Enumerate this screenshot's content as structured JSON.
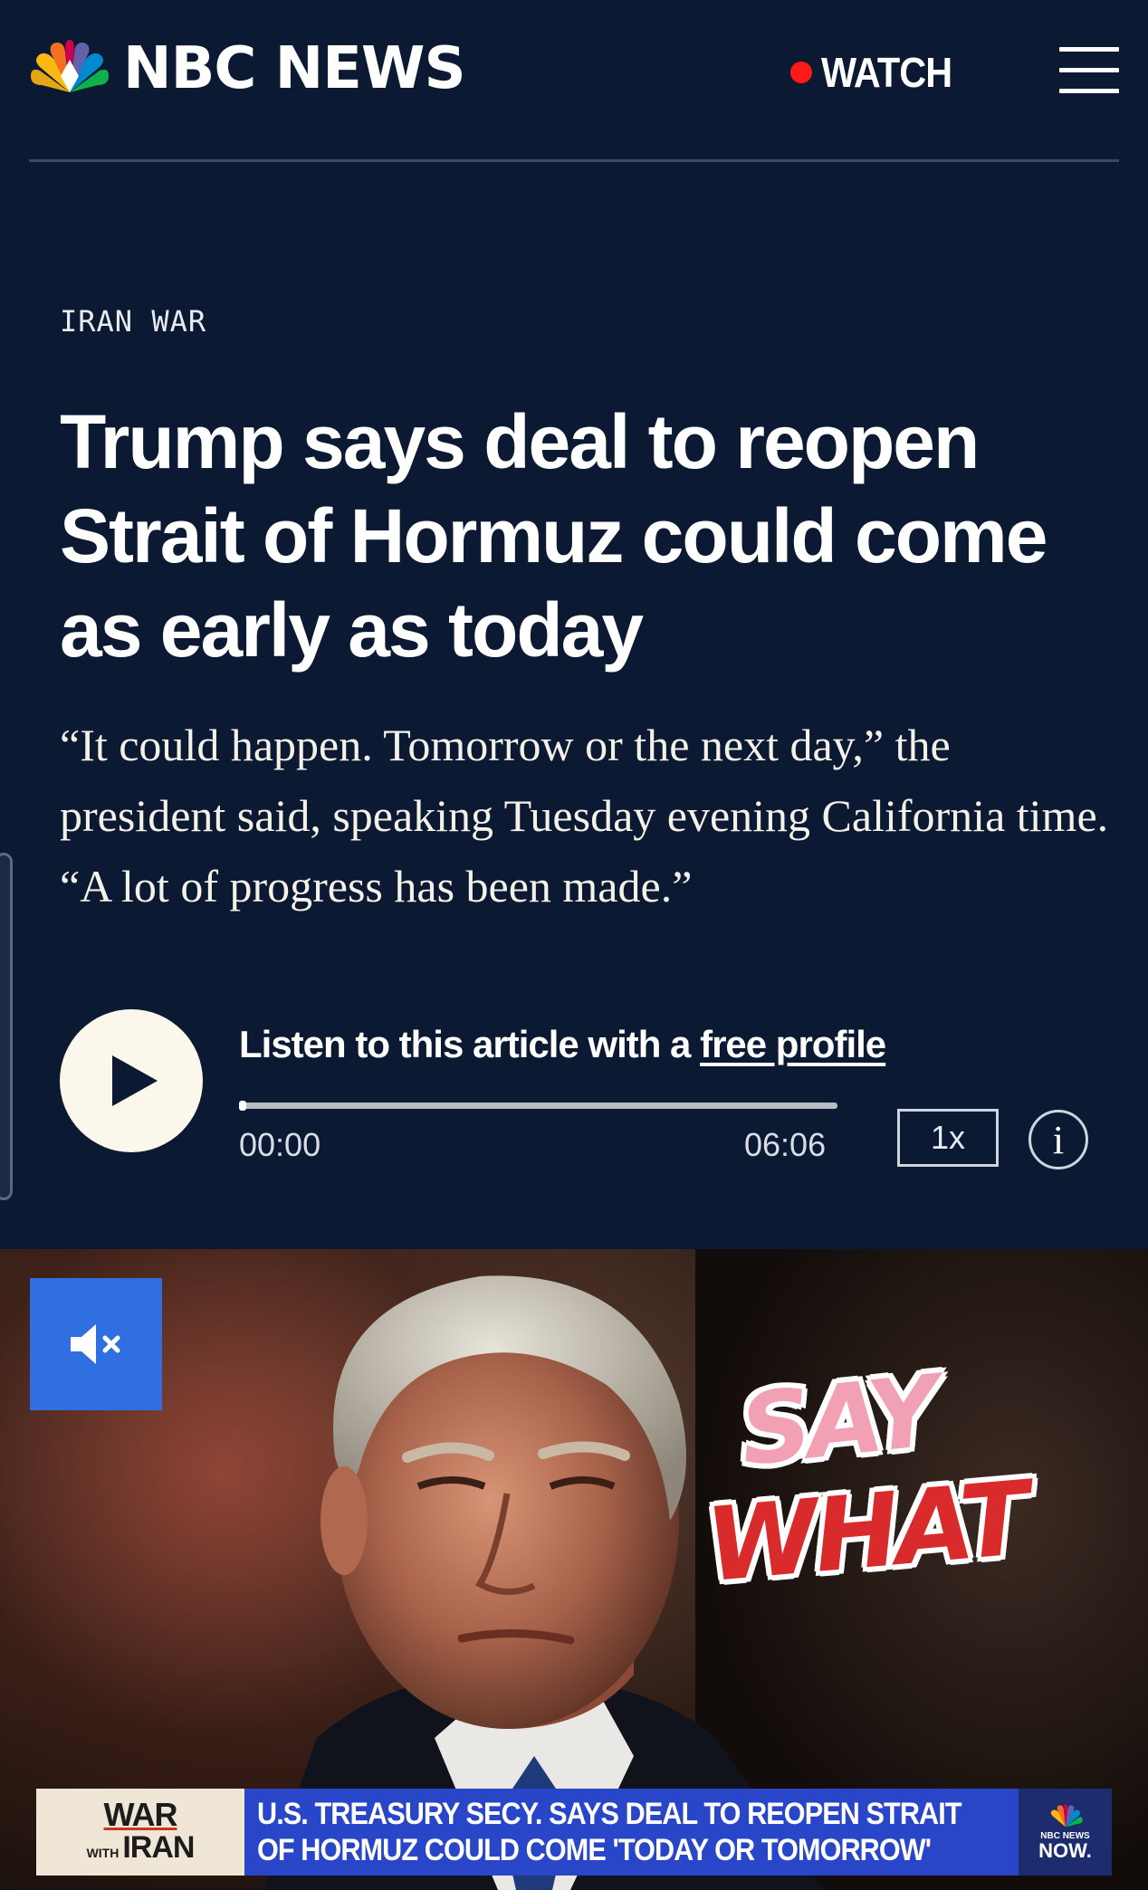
{
  "header": {
    "brand": "NBC NEWS",
    "watch_label": "WATCH"
  },
  "article": {
    "kicker": "IRAN WAR",
    "headline": "Trump says deal to reopen Strait of Hormuz could come as early as today",
    "dek": "“It could happen. Tomorrow or the next day,” the president said, speaking Tuesday evening California time. “A lot of progress has been made.”"
  },
  "audio": {
    "listen_prefix": "Listen to this article with a",
    "listen_link": "free profile",
    "current_time": "00:00",
    "duration": "06:06",
    "speed": "1x",
    "info_glyph": "i",
    "progress": 0.0
  },
  "video": {
    "sticker_top": "SAY",
    "sticker_bottom": "WHAT",
    "chyron": {
      "tag_top": "WAR",
      "tag_with": "WITH",
      "tag_bottom": "IRAN",
      "line1": "U.S. TREASURY SECY. SAYS DEAL TO REOPEN STRAIT",
      "line2": "OF HORMUZ COULD COME 'TODAY OR TOMORROW'",
      "brand_small": "NBC NEWS",
      "brand_now": "NOW."
    }
  },
  "icons": {
    "logo": "nbc-peacock-icon",
    "menu": "hamburger-menu-icon",
    "play": "play-icon",
    "mute": "muted-speaker-icon",
    "info": "info-icon"
  },
  "colors": {
    "background": "#0b1a32",
    "live_dot": "#ff1a1a",
    "mute_button": "#2f6fe0",
    "chyron_blue": "#2946c8"
  }
}
